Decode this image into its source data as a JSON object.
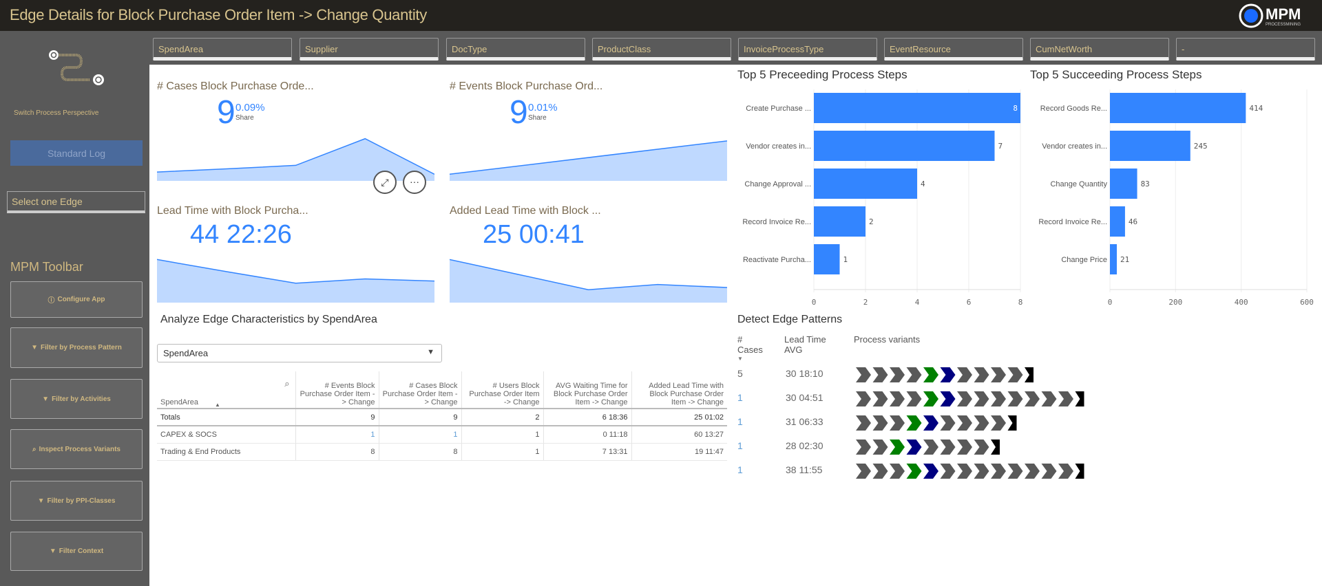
{
  "header": {
    "title": "Edge Details for Block Purchase Order Item -> Change Quantity",
    "logo_text": "MPM",
    "logo_sub": "PROCESSMINING"
  },
  "sidebar": {
    "switch_label": "Switch Process Perspective",
    "standard_log": "Standard Log",
    "edge_select": "Select one Edge",
    "toolbar_title": "MPM Toolbar",
    "buttons": [
      {
        "label": "Configure App",
        "icon": "info-icon",
        "glyph": "ⓘ"
      },
      {
        "label": "Filter by Process Pattern",
        "icon": "filter-icon",
        "glyph": "▼"
      },
      {
        "label": "Filter by Activities",
        "icon": "filter-icon",
        "glyph": "▼"
      },
      {
        "label": "Inspect Process Variants",
        "icon": "search-icon",
        "glyph": "⌕"
      },
      {
        "label": "Filter by PPI-Classes",
        "icon": "filter-icon",
        "glyph": "▼"
      },
      {
        "label": "Filter Context",
        "icon": "filter-icon",
        "glyph": "▼"
      }
    ]
  },
  "filters": [
    "SpendArea",
    "Supplier",
    "DocType",
    "ProductClass",
    "InvoiceProcessType",
    "EventResource",
    "CumNetWorth",
    "-"
  ],
  "kpis": [
    {
      "title": "# Cases Block Purchase Orde...",
      "value": "9",
      "share": "0.09%",
      "share_label": "Share",
      "sparkline": [
        0.2,
        0.27,
        0.35,
        0.95,
        0.15
      ]
    },
    {
      "title": "# Events Block Purchase Ord...",
      "value": "9",
      "share": "0.01%",
      "share_label": "Share",
      "sparkline": [
        0.15,
        0.9
      ]
    },
    {
      "title": "Lead Time with Block Purcha...",
      "value": "44 22:26",
      "sparkline": [
        1.0,
        0.72,
        0.45,
        0.55,
        0.5
      ]
    },
    {
      "title": "Added Lead Time with Block ...",
      "value": "25 00:41",
      "sparkline": [
        1.0,
        0.65,
        0.3,
        0.42,
        0.35
      ]
    }
  ],
  "chart_data": [
    {
      "type": "bar",
      "orientation": "horizontal",
      "title": "Top 5 Preceeding Process Steps",
      "categories": [
        "Create Purchase ...",
        "Vendor creates in...",
        "Change Approval ...",
        "Record Invoice Re...",
        "Reactivate Purcha..."
      ],
      "values": [
        8,
        7,
        4,
        2,
        1
      ],
      "xlim": [
        0,
        8
      ],
      "ticks": [
        0,
        2,
        4,
        6,
        8
      ],
      "grid": true,
      "color": "#3385ff"
    },
    {
      "type": "bar",
      "orientation": "horizontal",
      "title": "Top 5 Succeeding Process Steps",
      "categories": [
        "Record Goods Re...",
        "Vendor creates in...",
        "Change Quantity",
        "Record Invoice Re...",
        "Change Price"
      ],
      "values": [
        414,
        245,
        83,
        46,
        21
      ],
      "xlim": [
        0,
        600
      ],
      "ticks": [
        0,
        200,
        400,
        600
      ],
      "grid": true,
      "color": "#3385ff"
    }
  ],
  "analyze": {
    "title": "Analyze Edge Characteristics by SpendArea",
    "dropdown": "SpendArea",
    "columns": [
      "SpendArea",
      "# Events Block Purchase Order Item -> Change",
      "# Cases Block Purchase Order Item -> Change",
      "# Users Block Purchase Order Item -> Change",
      "AVG Waiting Time for Block Purchase Order Item -> Change",
      "Added Lead Time with Block Purchase Order Item -> Change"
    ],
    "totals": [
      "Totals",
      "9",
      "9",
      "2",
      "6 18:36",
      "25 01:02"
    ],
    "rows": [
      [
        "CAPEX & SOCS",
        "1",
        "1",
        "1",
        "0 11:18",
        "60 13:27"
      ],
      [
        "Trading & End Products",
        "8",
        "8",
        "1",
        "7 13:31",
        "19 11:47"
      ]
    ]
  },
  "patterns": {
    "title": "Detect Edge Patterns",
    "col_cases": "# Cases",
    "col_lead": "Lead Time AVG",
    "col_variants": "Process variants",
    "colors": {
      "step": "#595959",
      "source": "#008000",
      "target": "#000080",
      "end": "#000000"
    },
    "rows": [
      {
        "cases": "5",
        "lead": "30 18:10",
        "steps": "ggggsbggggE"
      },
      {
        "cases": "1",
        "lead": "30 04:51",
        "steps": "ggggsbgggggggE"
      },
      {
        "cases": "1",
        "lead": "31 06:33",
        "steps": "gggsbggggE"
      },
      {
        "cases": "1",
        "lead": "28 02:30",
        "steps": "ggsbggggE"
      },
      {
        "cases": "1",
        "lead": "38 11:55",
        "steps": "gggsbggggggggE"
      }
    ]
  }
}
